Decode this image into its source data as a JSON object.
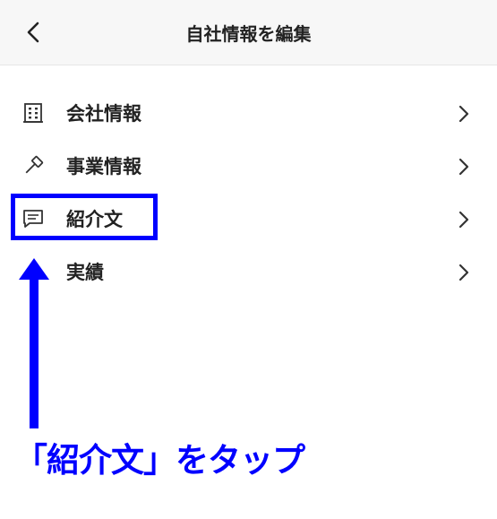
{
  "header": {
    "title": "自社情報を編集",
    "back_icon": "chevron-left-icon"
  },
  "menu": {
    "items": [
      {
        "label": "会社情報",
        "icon": "building-icon"
      },
      {
        "label": "事業情報",
        "icon": "gavel-icon"
      },
      {
        "label": "紹介文",
        "icon": "message-icon"
      },
      {
        "label": "実績",
        "icon": ""
      }
    ]
  },
  "annotation": {
    "instruction": "「紹介文」をタップ",
    "color": "#0000ff"
  }
}
